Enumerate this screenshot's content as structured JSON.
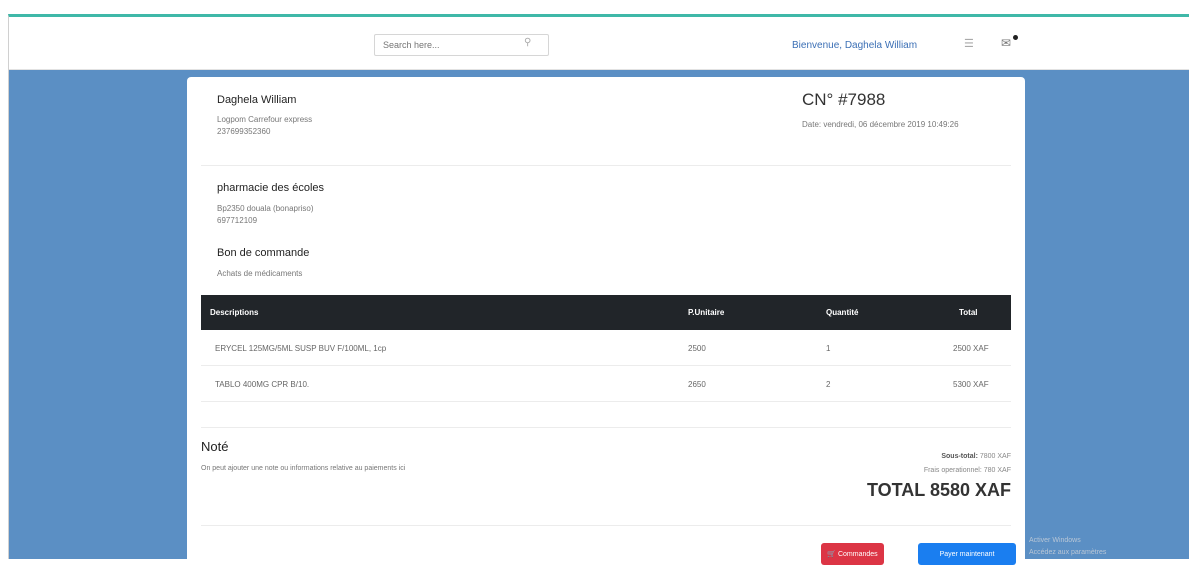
{
  "header": {
    "search_placeholder": "Search here...",
    "search_icon": "search-icon",
    "welcome": "Bienvenue, Daghela William",
    "list_icon": "list-icon",
    "mail_icon": "mail-icon"
  },
  "invoice": {
    "from": {
      "name": "Daghela William",
      "address": "Logpom Carrefour express",
      "phone": "237699352360"
    },
    "number": "CN° #7988",
    "date": "Date: vendredi, 06 décembre 2019 10:49:26",
    "to": {
      "name": "pharmacie des écoles",
      "address": "Bp2350 douala (bonapriso)",
      "phone": "697712109"
    },
    "order_title": "Bon de commande",
    "order_subtitle": "Achats de médicaments"
  },
  "table": {
    "headers": [
      "Descriptions",
      "P.Unitaire",
      "Quantité",
      "Total"
    ],
    "rows": [
      {
        "description": "ERYCEL 125MG/5ML SUSP BUV F/100ML, 1cp",
        "unit_price": "2500",
        "quantity": "1",
        "total": "2500 XAF"
      },
      {
        "description": "TABLO 400MG CPR B/10.",
        "unit_price": "2650",
        "quantity": "2",
        "total": "5300 XAF"
      }
    ]
  },
  "note": {
    "title": "Noté",
    "text": "On peut ajouter une note ou informations relative au paiements ici"
  },
  "summary": {
    "subtotal_label": "Sous-total:",
    "subtotal_value": "7800 XAF",
    "fees": "Frais operationnel: 780 XAF",
    "total": "TOTAL 8580 XAF"
  },
  "buttons": {
    "orders_label": "Commandes",
    "orders_icon": "cart-icon",
    "pay_label": "Payer maintenant"
  },
  "watermark": {
    "line1": "Activer Windows",
    "line2": "Accédez aux paramètres"
  }
}
